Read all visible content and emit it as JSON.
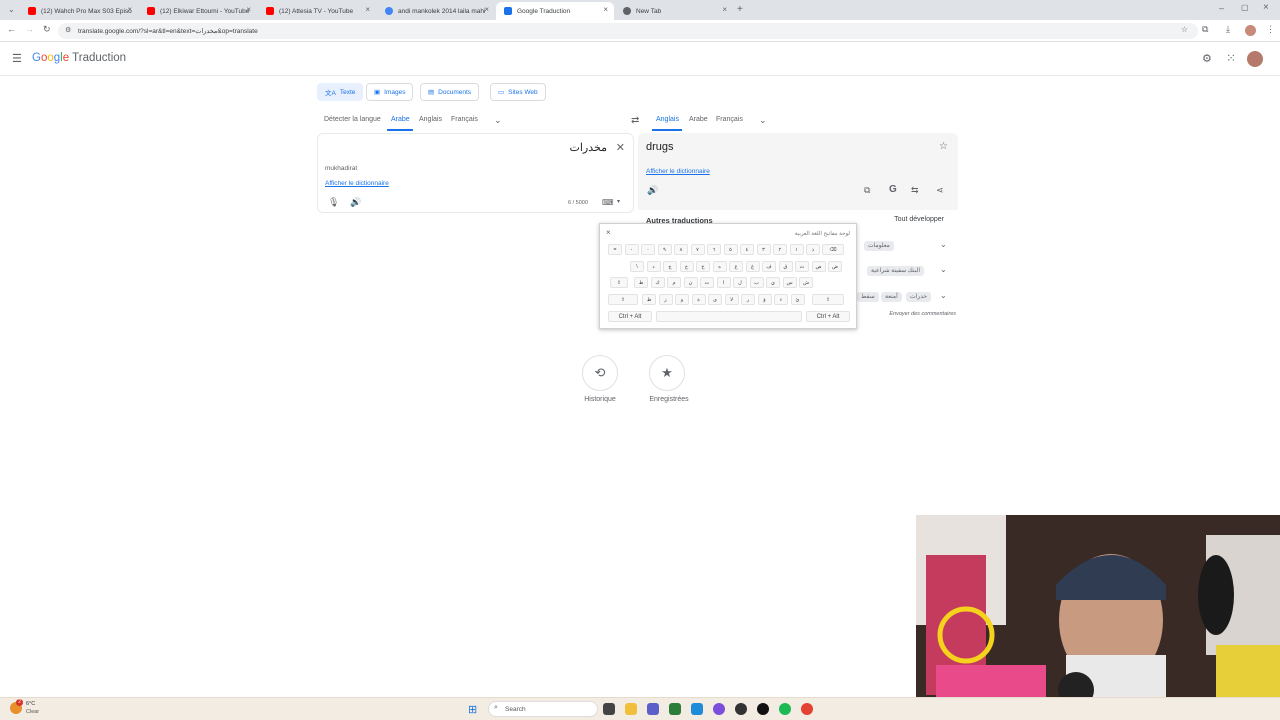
{
  "browser": {
    "tabs": [
      {
        "title": "(12) Wahch Pro Max S03 Episo",
        "color": "#ff0000"
      },
      {
        "title": "(12) Elkiwar Ettoumi - YouTube",
        "color": "#ff0000"
      },
      {
        "title": "(12) Attesia TV - YouTube",
        "color": "#ff0000"
      },
      {
        "title": "andi mankolek 2014 laila mahi",
        "color": "#4285f4"
      },
      {
        "title": "Google Traduction",
        "color": "#1a73e8"
      },
      {
        "title": "New Tab",
        "color": "#5f6368"
      }
    ],
    "url": "translate.google.com/?sl=ar&tl=en&text=مخدرات&op=translate"
  },
  "header": {
    "logo_google": "Google",
    "logo_product": "Traduction"
  },
  "modes": [
    "Texte",
    "Images",
    "Documents",
    "Sites Web"
  ],
  "source_langs": [
    "Détecter la langue",
    "Arabe",
    "Anglais",
    "Français"
  ],
  "target_langs": [
    "Anglais",
    "Arabe",
    "Français"
  ],
  "source": {
    "text": "مخدرات",
    "transliteration": "mukhadirat",
    "dictionary_link": "Afficher le dictionnaire",
    "char_count": "6 / 5000"
  },
  "target": {
    "text": "drugs",
    "dictionary_link": "Afficher le dictionnaire"
  },
  "other_translations": {
    "title": "Autres traductions",
    "expand": "Tout développer",
    "chips": [
      "معلومات",
      "البنك سفينة شراعية",
      "خدرات",
      "أمتعة",
      "سقط"
    ],
    "feedback": "Envoyer des commentaires"
  },
  "keyboard": {
    "title": "لوحة مفاتيح اللغة العربية",
    "row1": [
      "ذ",
      "١",
      "٢",
      "٣",
      "٤",
      "٥",
      "٦",
      "٧",
      "٨",
      "٩",
      "٠",
      "-",
      "="
    ],
    "row2": [
      "ض",
      "ص",
      "ث",
      "ق",
      "ف",
      "غ",
      "ع",
      "ه",
      "خ",
      "ح",
      "ج",
      "د",
      "\\"
    ],
    "row3": [
      "ش",
      "س",
      "ي",
      "ب",
      "ل",
      "ا",
      "ت",
      "ن",
      "م",
      "ك",
      "ط"
    ],
    "row4": [
      "ئ",
      "ء",
      "ؤ",
      "ر",
      "لا",
      "ى",
      "ة",
      "و",
      "ز",
      "ظ"
    ],
    "ctrl_left": "Ctrl + Alt",
    "ctrl_right": "Ctrl + Alt"
  },
  "bottom": {
    "history_label": "Historique",
    "saved_label": "Enregistrées"
  },
  "taskbar": {
    "weather_temp": "6°C",
    "weather_desc": "Clear",
    "search_placeholder": "Search",
    "notif_count": "2"
  }
}
